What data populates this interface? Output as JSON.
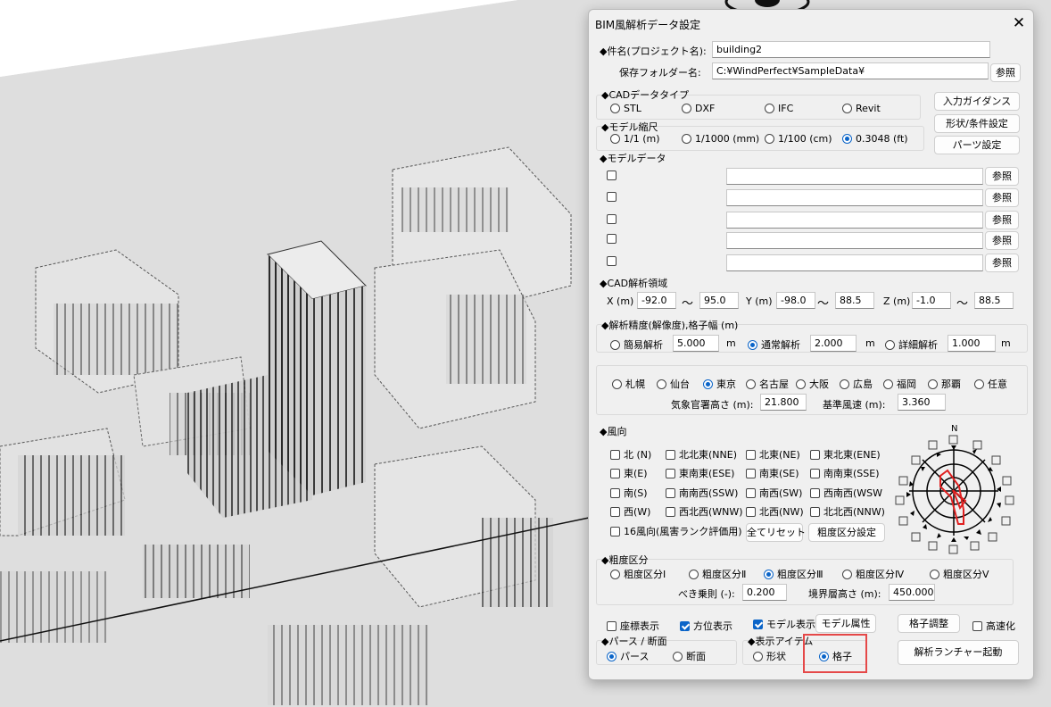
{
  "dialog": {
    "title": "BIM風解析データ設定",
    "project": {
      "label": "◆件名(プロジェクト名):",
      "value": "building2"
    },
    "folder": {
      "label": "保存フォルダー名:",
      "value": "C:¥WindPerfect¥SampleData¥",
      "browse": "参照"
    },
    "cad_type": {
      "label": "◆CADデータタイプ",
      "options": [
        "STL",
        "DXF",
        "IFC",
        "Revit"
      ],
      "selected": ""
    },
    "side_buttons": [
      "入力ガイダンス",
      "形状/条件設定",
      "パーツ設定"
    ],
    "scale": {
      "label": "◆モデル縮尺",
      "options": [
        "1/1 (m)",
        "1/1000 (mm)",
        "1/100 (cm)",
        "0.3048 (ft)"
      ],
      "selected": "0.3048 (ft)"
    },
    "model_data": {
      "label": "◆モデルデータ",
      "rows": [
        "",
        "",
        "",
        "",
        ""
      ],
      "browse": "参照"
    },
    "region": {
      "label": "◆CAD解析領域",
      "x_label": "X (m)",
      "x_min": "-92.0",
      "x_max": "95.0",
      "y_label": "Y (m)",
      "y_min": "-98.0",
      "y_max": "88.5",
      "z_label": "Z (m)",
      "z_min": "-1.0",
      "z_max": "88.5",
      "tilde": "～"
    },
    "precision": {
      "label": "◆解析精度(解像度),格子幅 (m)",
      "unit": "m",
      "options": [
        {
          "label": "簡易解析",
          "value": "5.000"
        },
        {
          "label": "通常解析",
          "value": "2.000"
        },
        {
          "label": "詳細解析",
          "value": "1.000"
        }
      ],
      "selected": "通常解析"
    },
    "city": {
      "options": [
        "札幌",
        "仙台",
        "東京",
        "名古屋",
        "大阪",
        "広島",
        "福岡",
        "那覇",
        "任意"
      ],
      "selected": "東京",
      "station_height_label": "気象官署高さ (m):",
      "station_height": "21.800",
      "ref_speed_label": "基準風速 (m):",
      "ref_speed": "3.360"
    },
    "wind": {
      "label": "◆風向",
      "directions": [
        "北 (N)",
        "北北東(NNE)",
        "北東(NE)",
        "東北東(ENE)",
        "東(E)",
        "東南東(ESE)",
        "南東(SE)",
        "南南東(SSE)",
        "南(S)",
        "南南西(SSW)",
        "南西(SW)",
        "西南西(WSW",
        "西(W)",
        "西北西(WNW)",
        "北西(NW)",
        "北北西(NNW)"
      ],
      "sixteen_label": "16風向(風害ランク評価用)",
      "reset": "全てリセット",
      "roughness_btn": "粗度区分設定",
      "compass_n": "N"
    },
    "roughness": {
      "label": "◆粗度区分",
      "options": [
        "粗度区分Ⅰ",
        "粗度区分Ⅱ",
        "粗度区分Ⅲ",
        "粗度区分Ⅳ",
        "粗度区分Ⅴ"
      ],
      "selected": "粗度区分Ⅲ",
      "power_label": "べき乗則 (-):",
      "power": "0.200",
      "boundary_label": "境界層高さ (m):",
      "boundary": "450.000"
    },
    "display": {
      "coord": "座標表示",
      "compass": "方位表示",
      "model": "モデル表示",
      "model_attr": "モデル属性",
      "grid_adjust": "格子調整",
      "fast": "高速化"
    },
    "perspective": {
      "label": "◆パース / 断面",
      "options": [
        "パース",
        "断面"
      ],
      "selected": "パース"
    },
    "display_item": {
      "label": "◆表示アイテム",
      "options": [
        "形状",
        "格子"
      ],
      "selected": "格子"
    },
    "launch": "解析ランチャー起動"
  },
  "colors": {
    "accent": "#0a64c8",
    "highlight": "#e54848",
    "wind_rose": "#e02020"
  }
}
